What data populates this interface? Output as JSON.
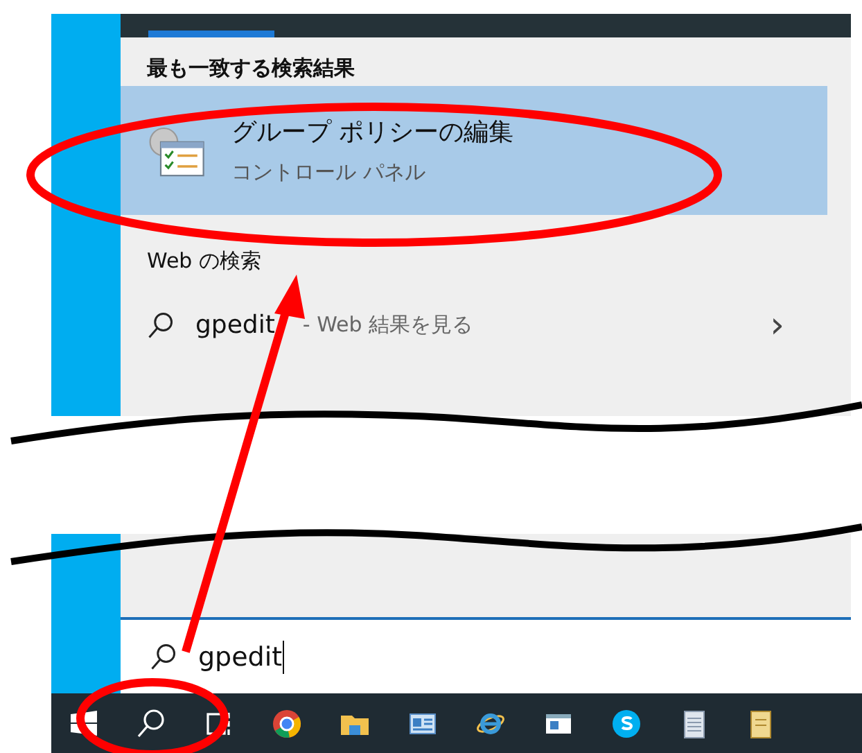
{
  "best_match": {
    "heading": "最も一致する検索結果",
    "result": {
      "title": "グループ ポリシーの編集",
      "subtitle": "コントロール パネル",
      "selected": true
    }
  },
  "web_search": {
    "heading": "Web の検索",
    "query": "gpedit",
    "suffix": "- Web 結果を見る",
    "chevron": "›"
  },
  "search_box": {
    "value": "gpedit"
  }
}
